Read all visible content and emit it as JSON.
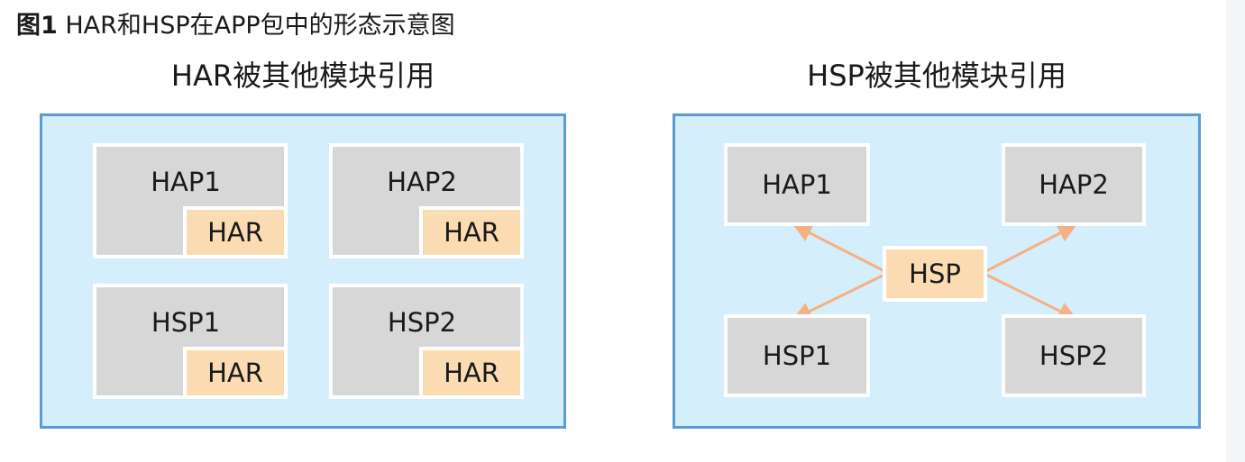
{
  "caption": {
    "number": "图1",
    "text": " HAR和HSP在APP包中的形态示意图"
  },
  "left_panel": {
    "title": "HAR被其他模块引用",
    "modules": [
      {
        "label": "HAP1",
        "chip": "HAR"
      },
      {
        "label": "HAP2",
        "chip": "HAR"
      },
      {
        "label": "HSP1",
        "chip": "HAR"
      },
      {
        "label": "HSP2",
        "chip": "HAR"
      }
    ]
  },
  "right_panel": {
    "title": "HSP被其他模块引用",
    "center": "HSP",
    "modules": [
      {
        "label": "HAP1"
      },
      {
        "label": "HAP2"
      },
      {
        "label": "HSP1"
      },
      {
        "label": "HSP2"
      }
    ]
  },
  "colors": {
    "panel_fill": "#d5eefb",
    "panel_border": "#5b9bd5",
    "module_fill": "#d7d7d7",
    "chip_fill": "#fbdcb2",
    "arrow": "#f4b183"
  }
}
